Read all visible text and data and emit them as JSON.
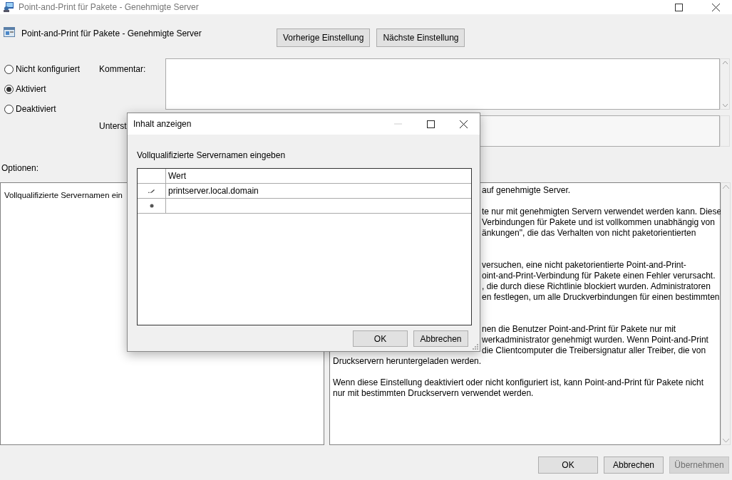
{
  "window": {
    "title": "Point-and-Print für Pakete - Genehmigte Server"
  },
  "header": {
    "title": "Point-and-Print für Pakete - Genehmigte Server",
    "buttons": [
      "Vorherige Einstellung",
      "Nächste Einstellung"
    ]
  },
  "state_options": [
    {
      "label": "Nicht konfiguriert",
      "selected": false
    },
    {
      "label": "Aktiviert",
      "selected": true
    },
    {
      "label": "Deaktiviert",
      "selected": false
    }
  ],
  "comment": {
    "label": "Kommentar:"
  },
  "supported": {
    "label": "Unterst"
  },
  "options": {
    "label": "Optionen:",
    "text": "Vollqualifizierte Servernamen ein"
  },
  "help": {
    "paragraphs": [
      {
        "lines": [
          {
            "kind": "clipped",
            "text": "auf genehmigte Server."
          }
        ]
      },
      {
        "lines": [
          {
            "kind": "clipped",
            "text": "te nur mit genehmigten Servern verwendet werden kann. Diese"
          },
          {
            "kind": "clipped",
            "text": "Verbindungen für Pakete und ist vollkommen unabhängig von"
          },
          {
            "kind": "clipped",
            "text": "änkungen\", die das Verhalten von nicht paketorientierten"
          }
        ]
      },
      {
        "lines": [
          {
            "kind": "clipped",
            "text": "versuchen, eine nicht paketorientierte Point-and-Print-"
          },
          {
            "kind": "clipped",
            "text": "oint-and-Print-Verbindung für Pakete einen Fehler verursacht."
          },
          {
            "kind": "clipped",
            "text": ", die durch diese Richtlinie blockiert wurden. Administratoren"
          },
          {
            "kind": "clipped",
            "text": "en festlegen, um alle Druckverbindungen für einen bestimmten"
          }
        ]
      },
      {
        "lines": [
          {
            "kind": "clipped",
            "text": "nen die Benutzer Point-and-Print für Pakete nur mit"
          },
          {
            "kind": "clipped",
            "text": "werkadministrator genehmigt wurden. Wenn Point-and-Print"
          },
          {
            "kind": "clipped",
            "text": "die Clientcomputer die Treibersignatur aller Treiber, die von"
          },
          {
            "kind": "full",
            "text": "Druckservern heruntergeladen werden."
          }
        ]
      },
      {
        "lines": [
          {
            "kind": "full",
            "text": "Wenn diese Einstellung deaktiviert oder nicht konfiguriert ist, kann Point-and-Print für Pakete nicht"
          },
          {
            "kind": "full",
            "text": "nur mit bestimmten Druckservern verwendet werden."
          }
        ]
      }
    ]
  },
  "buttons": [
    {
      "label": "OK",
      "disabled": false
    },
    {
      "label": "Abbrechen",
      "disabled": false
    },
    {
      "label": "Übernehmen",
      "disabled": true
    }
  ],
  "dialog": {
    "title": "Inhalt anzeigen",
    "prompt": "Vollqualifizierte Servernamen eingeben",
    "table": {
      "columns": [
        "Wert"
      ],
      "rows": [
        {
          "kind": "edit",
          "value": "printserver.local.domain"
        },
        {
          "kind": "new"
        }
      ]
    },
    "buttons": [
      "OK",
      "Abbrechen"
    ]
  }
}
